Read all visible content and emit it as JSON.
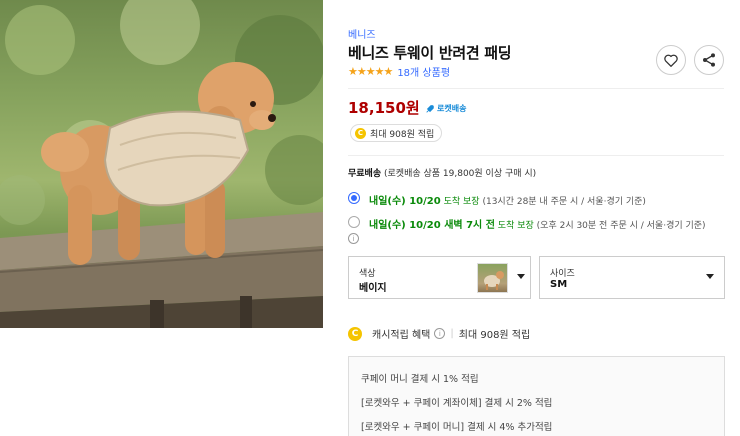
{
  "product": {
    "brand": "베니즈",
    "title": "베니즈 투웨이 반려견 패딩",
    "stars": "★★★★★",
    "review_count": "18개 상품평",
    "rating": 4.5
  },
  "price": {
    "amount": "18,150원",
    "rocket_label": "로켓배송",
    "cash_pill": "최대 908원 적립",
    "coin_glyph": "C"
  },
  "shipping": {
    "label": "무료배송",
    "detail": "(로켓배송 상품 19,800원 이상 구매 시)",
    "options": [
      {
        "date": "내일(수) 10/20",
        "guarantee": "도착 보장",
        "condition": "(13시간 28분 내 주문 시 / 서울·경기 기준)",
        "selected": true
      },
      {
        "date": "내일(수) 10/20 새벽 7시 전",
        "guarantee": "도착 보장",
        "condition": "(오후 2시 30분 전 주문 시 / 서울·경기 기준)",
        "selected": false
      }
    ],
    "info_glyph": "i"
  },
  "selectors": {
    "color_label": "색상",
    "color_value": "베이지",
    "size_label": "사이즈",
    "size_value": "SM"
  },
  "cashback": {
    "label": "캐시적립 혜택",
    "separator": "|",
    "max": "최대 908원 적립",
    "benefits": [
      "쿠페이 머니 결제 시 1% 적립",
      "[로켓와우 + 쿠페이 계좌이체] 결제 시 2% 적립",
      "[로켓와우 + 쿠페이 머니] 결제 시 4% 추가적립"
    ]
  },
  "colors": {
    "accent_blue": "#346aff",
    "price_red": "#ae0000",
    "delivery_green": "#0a8a0a",
    "star_orange": "#f5a31a",
    "coin_yellow": "#f5c400"
  },
  "icons": [
    "heart-icon",
    "share-icon",
    "rocket-icon",
    "coin-icon",
    "info-icon",
    "caret-down-icon"
  ]
}
